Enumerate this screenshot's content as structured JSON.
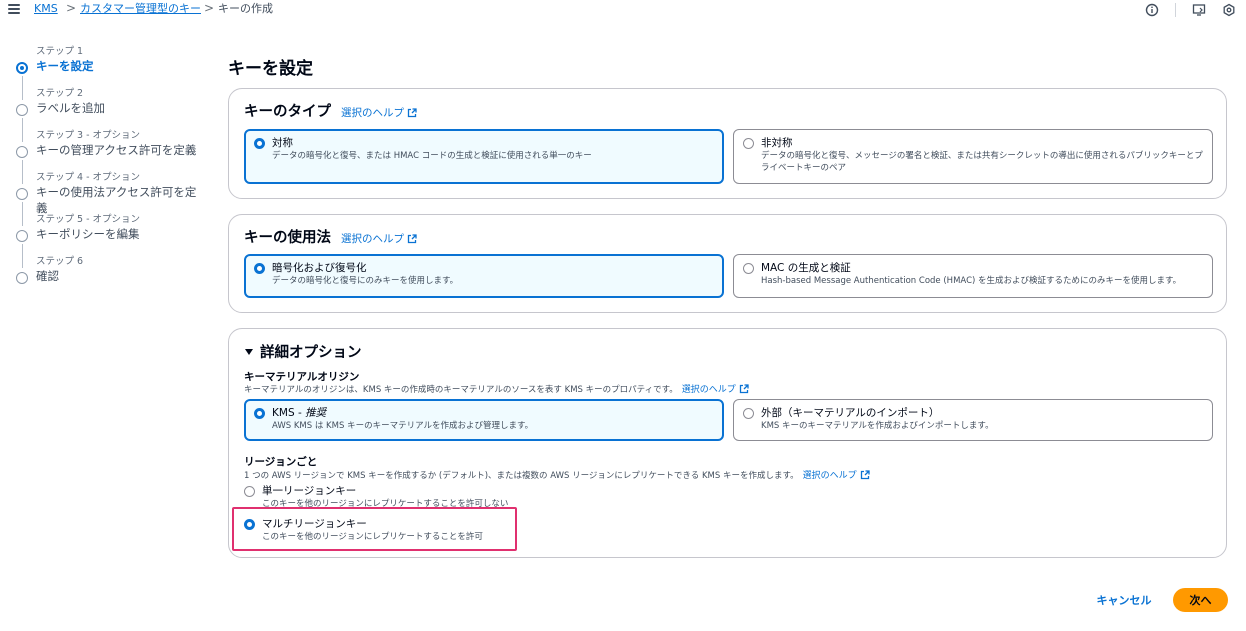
{
  "breadcrumb": {
    "items": [
      "KMS",
      "カスタマー管理型のキー",
      "キーの作成"
    ],
    "separator": ">"
  },
  "steps": [
    {
      "small": "ステップ 1",
      "name": "キーを設定",
      "active": true
    },
    {
      "small": "ステップ 2",
      "name": "ラベルを追加"
    },
    {
      "small": "ステップ 3 - オプション",
      "name": "キーの管理アクセス許可を定義"
    },
    {
      "small": "ステップ 4 - オプション",
      "name": "キーの使用法アクセス許可を定義"
    },
    {
      "small": "ステップ 5 - オプション",
      "name": "キーポリシーを編集"
    },
    {
      "small": "ステップ 6",
      "name": "確認"
    }
  ],
  "page_title": "キーを設定",
  "help_label": "選択のヘルプ",
  "key_type": {
    "title": "キーのタイプ",
    "options": [
      {
        "label": "対称",
        "desc": "データの暗号化と復号、または HMAC コードの生成と検証に使用される単一のキー",
        "selected": true
      },
      {
        "label": "非対称",
        "desc": "データの暗号化と復号、メッセージの署名と検証、または共有シークレットの導出に使用されるパブリックキーとプライベートキーのペア",
        "selected": false
      }
    ]
  },
  "key_usage": {
    "title": "キーの使用法",
    "options": [
      {
        "label": "暗号化および復号化",
        "desc": "データの暗号化と復号にのみキーを使用します。",
        "selected": true
      },
      {
        "label": "MAC の生成と検証",
        "desc": "Hash-based Message Authentication Code (HMAC) を生成および検証するためにのみキーを使用します。",
        "selected": false
      }
    ]
  },
  "advanced": {
    "title": "詳細オプション",
    "origin": {
      "label": "キーマテリアルオリジン",
      "desc": "キーマテリアルのオリジンは、KMS キーの作成時のキーマテリアルのソースを表す KMS キーのプロパティです。",
      "options": [
        {
          "label": "KMS - ",
          "label_em": "推奨",
          "desc": "AWS KMS は KMS キーのキーマテリアルを作成および管理します。",
          "selected": true
        },
        {
          "label": "外部（キーマテリアルのインポート）",
          "desc": "KMS キーのキーマテリアルを作成およびインポートします。",
          "selected": false
        }
      ]
    },
    "region": {
      "label": "リージョンごと",
      "desc": "1 つの AWS リージョンで KMS キーを作成するか (デフォルト)、または複数の AWS リージョンにレプリケートできる KMS キーを作成します。",
      "options": [
        {
          "label": "単一リージョンキー",
          "desc": "このキーを他のリージョンにレプリケートすることを許可しない",
          "selected": false
        },
        {
          "label": "マルチリージョンキー",
          "desc": "このキーを他のリージョンにレプリケートすることを許可",
          "selected": true
        }
      ]
    }
  },
  "actions": {
    "cancel": "キャンセル",
    "next": "次へ"
  },
  "colors": {
    "accent": "#0972d3",
    "primary_button": "#ff9900",
    "highlight_box": "#e0306f"
  }
}
